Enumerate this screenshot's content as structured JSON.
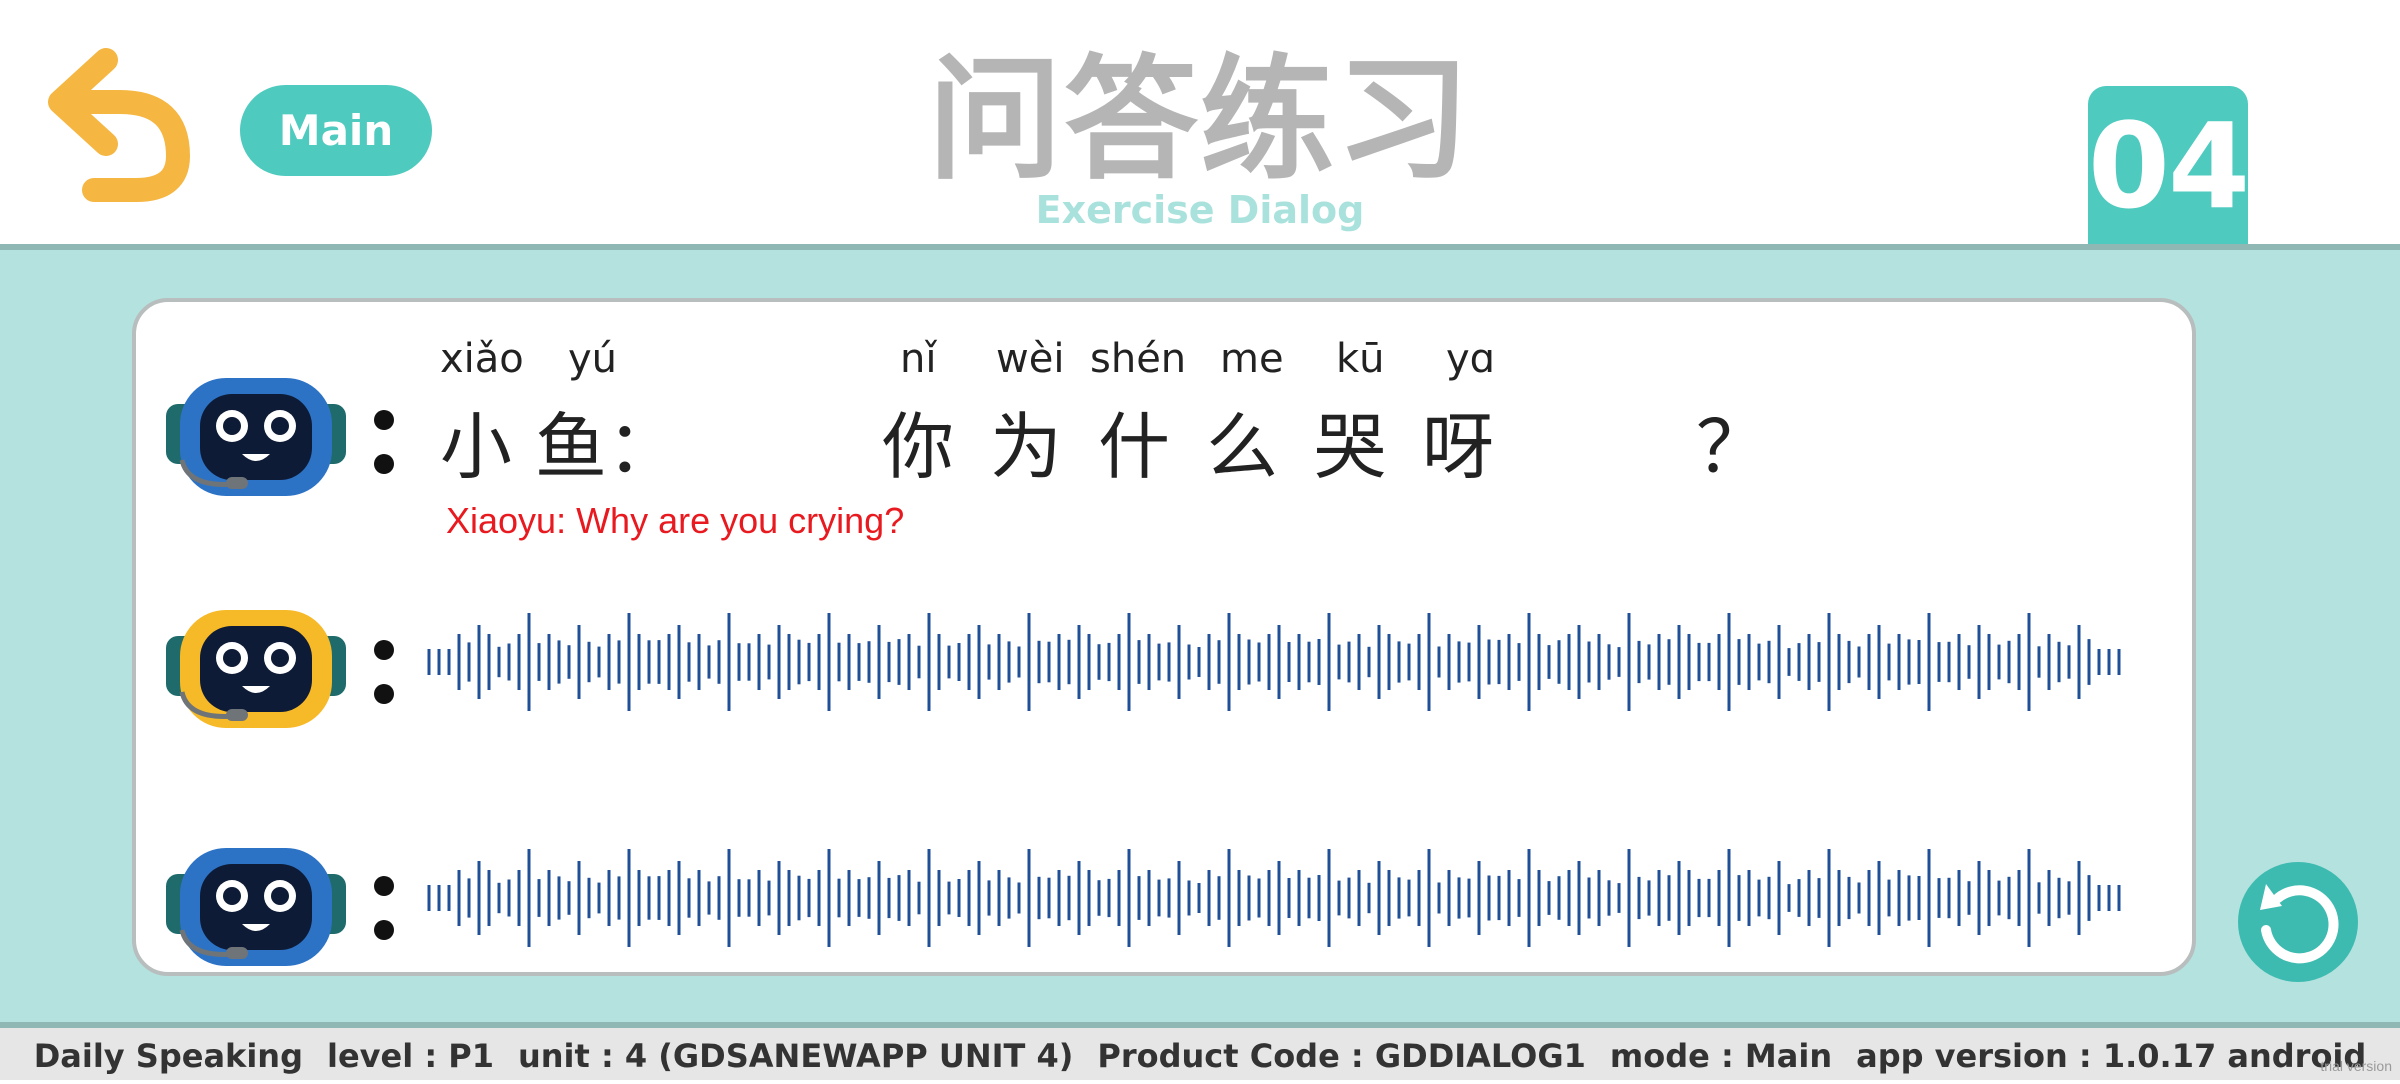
{
  "header": {
    "main_label": "Main",
    "title_cn": "问答练习",
    "title_en": "Exercise Dialog",
    "lesson_number": "04"
  },
  "dialog": {
    "line1": {
      "speaker_pinyin": [
        "xiǎo",
        "yú"
      ],
      "speaker_hanzi": "小 鱼：",
      "sentence_pinyin": [
        "nǐ",
        "wèi",
        "shén",
        "me",
        "kū",
        "yɑ"
      ],
      "sentence_hanzi": [
        "你",
        "为",
        "什",
        "么",
        "哭",
        "呀"
      ],
      "punctuation": "？",
      "translation": "Xiaoyu: Why are you crying?"
    }
  },
  "footer": {
    "product": "Daily Speaking",
    "level": "level : P1",
    "unit": "unit : 4 (GDSANEWAPP UNIT 4)",
    "product_code": "Product Code : GDDIALOG1",
    "mode": "mode : Main",
    "app_version": "app version : 1.0.17 android",
    "watermark": "trial version"
  },
  "colors": {
    "accent": "#4ecabf",
    "back_arrow": "#f5b642",
    "main_bg": "#b3e2df",
    "wave": "#1f4f96",
    "translation": "#e8191f",
    "robot_blue": "#2d73c5",
    "robot_yellow": "#f6b928"
  },
  "icons": {
    "back": "undo-arrow-icon",
    "replay": "replay-icon",
    "speaker_a": "robot-blue-icon",
    "speaker_b": "robot-yellow-icon"
  }
}
